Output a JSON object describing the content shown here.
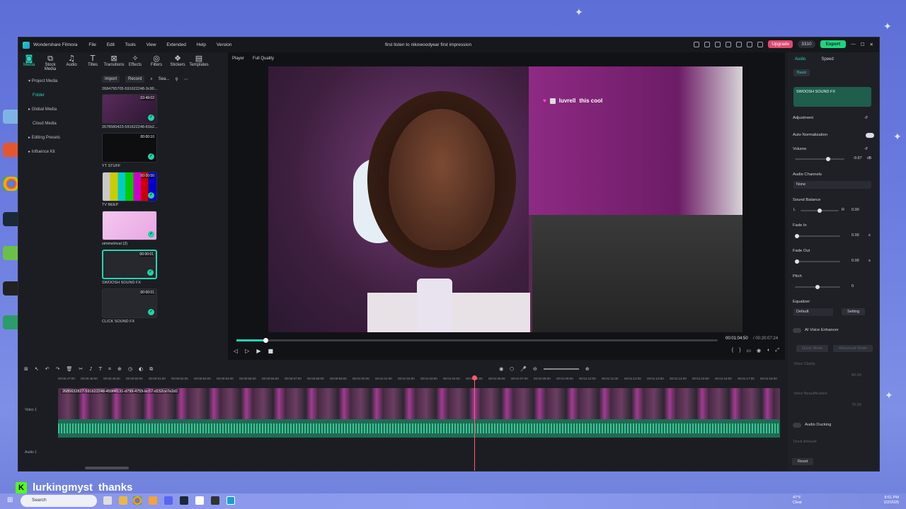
{
  "window": {
    "app_name": "Wondershare Filmora",
    "menu": [
      "File",
      "Edit",
      "Tools",
      "View",
      "Extended",
      "Help",
      "Version"
    ],
    "project_title": "first listen to nikowoodyear first impression",
    "upgrade_label": "Upgrade",
    "coins": "3310",
    "export_label": "Export"
  },
  "media_tabs": [
    {
      "label": "Media",
      "icon": "media-icon"
    },
    {
      "label": "Stock Media",
      "icon": "stock-media-icon"
    },
    {
      "label": "Audio",
      "icon": "audio-icon"
    },
    {
      "label": "Titles",
      "icon": "titles-icon"
    },
    {
      "label": "Transitions",
      "icon": "transitions-icon"
    },
    {
      "label": "Effects",
      "icon": "effects-icon"
    },
    {
      "label": "Filters",
      "icon": "filters-icon"
    },
    {
      "label": "Stickers",
      "icon": "stickers-icon"
    },
    {
      "label": "Templates",
      "icon": "templates-icon"
    }
  ],
  "project_nav": [
    "Project Media",
    "Folder",
    "Global Media",
    "Cloud Media",
    "Editing Presets",
    "Influence Kit"
  ],
  "media_toolbar": {
    "import": "Import",
    "record": "Record",
    "search_placeholder": "Sea..."
  },
  "media_items": [
    {
      "name": "2684795705-591622248-3c90...",
      "duration": "",
      "thumb": "stream"
    },
    {
      "name": "2678580423-591622248-81b2...",
      "duration": "03:49:02",
      "thumb": "stream"
    },
    {
      "name": "YT STUFF",
      "duration": "00:00:10",
      "thumb": "text"
    },
    {
      "name": "TV BEEP",
      "duration": "00:00:00",
      "thumb": "bars"
    },
    {
      "name": "simmetrical (3)",
      "duration": "",
      "thumb": "pink"
    },
    {
      "name": "SWOOSH SOUND FX",
      "duration": "00:00:01",
      "thumb": "audio"
    },
    {
      "name": "CLICK SOUND FX",
      "duration": "00:00:01",
      "thumb": "audio"
    }
  ],
  "player": {
    "label": "Player",
    "quality": "Full Quality",
    "current_time": "00:01:04:50",
    "total_time": "/ 00:20:07:24",
    "progress": 0.06,
    "overlay_user": "luvrell",
    "overlay_msg": "this cool"
  },
  "right_panel": {
    "tabs": [
      "Audio",
      "Speed"
    ],
    "basic": "Basic",
    "clip_name": "SWOOSH SOUND FX",
    "adjustment": "Adjustment",
    "auto_normalization": "Auto Normalization",
    "volume_label": "Volume",
    "volume_value": "-9.97",
    "volume_unit": "dB",
    "audio_channels": "Audio Channels",
    "audio_channels_value": "None",
    "sound_balance": "Sound Balance",
    "balance_l": "L",
    "balance_r": "R",
    "balance_value": "0.00",
    "fade_in": "Fade In",
    "fade_in_value": "0.00",
    "fade_out": "Fade Out",
    "fade_out_value": "0.00",
    "fade_unit": "s",
    "pitch": "Pitch",
    "pitch_value": "0",
    "equalizer": "Equalizer",
    "equalizer_value": "Default",
    "setting": "Setting",
    "ai_voice_enhancer": "AI Voice Enhancer",
    "quick_mode": "Quick Mode",
    "advanced_mode": "Advanced Mode",
    "voice_clarity": "Voice Clarity",
    "voice_clarity_value": "80.00",
    "voice_beautification": "Voice Beautification",
    "voice_beautification_value": "70.00",
    "audio_ducking": "Audio Ducking",
    "duck_amount": "Duck Amount",
    "reset": "Reset"
  },
  "timeline": {
    "ruler": [
      "00:00:47:00",
      "00:00:48:00",
      "00:00:49:00",
      "00:00:50:00",
      "00:00:51:00",
      "00:00:52:00",
      "00:00:53:00",
      "00:00:54:00",
      "00:00:55:00",
      "00:00:56:00",
      "00:00:57:00",
      "00:00:58:00",
      "00:00:59:00",
      "00:01:00:00",
      "00:01:01:00",
      "00:01:02:00",
      "00:01:03:00",
      "00:01:04:00",
      "00:01:05:00",
      "00:01:06:00",
      "00:01:07:00",
      "00:01:08:00",
      "00:01:09:00",
      "00:01:10:00",
      "00:01:11:00",
      "00:01:12:00",
      "00:01:13:00",
      "00:01:14:00",
      "00:01:15:00",
      "00:01:16:00",
      "00:01:17:00",
      "00:01:18:00"
    ],
    "video_track": "Video 1",
    "audio_track": "Audio 1",
    "clip_name": "2685632827-591622248-459f4f131-d799-4755-bc57-d152ce7e2d1"
  },
  "chat": {
    "user": "lurkingmyst",
    "message": "thanks"
  },
  "taskbar": {
    "search": "Search",
    "weather_temp": "47°F",
    "weather_desc": "Clear",
    "time": "8:51 PM",
    "date": "2/2/2025"
  },
  "colors": {
    "accent": "#23d6b6",
    "export": "#1fd47d",
    "upgrade": "#e0496d",
    "playhead": "#ff5a6a"
  }
}
